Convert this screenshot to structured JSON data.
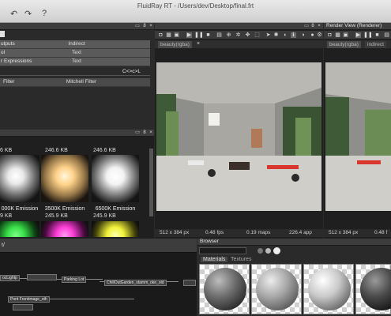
{
  "window": {
    "title": "FluidRay RT - /Users/dev/Desktop/final.frt"
  },
  "toolbar": {
    "undo": "↶",
    "redo": "↷",
    "help": "?"
  },
  "properties": {
    "rows": [
      {
        "label": "utputs",
        "value": "Indirect"
      },
      {
        "label": "ol",
        "value": "Text"
      },
      {
        "label": "r Expressions",
        "value": "Text"
      },
      {
        "label": "",
        "value": ""
      },
      {
        "label": "Filter",
        "value": "Mitchell Filter"
      }
    ],
    "shortcut": "C<>c>L"
  },
  "library": {
    "items": [
      {
        "size": "6 KB",
        "label": "000K Emission",
        "glow": "#f4f4f4"
      },
      {
        "size": "246.6 KB",
        "label": "3500K Emission",
        "glow": "#ffd79a"
      },
      {
        "size": "246.6 KB",
        "label": "6500K Emission",
        "glow": "#ffffff"
      },
      {
        "size": "9 KB",
        "label": "",
        "glow": "#39e04a"
      },
      {
        "size": "245.9 KB",
        "label": "",
        "glow": "#ff3fd8"
      },
      {
        "size": "245.9 KB",
        "label": "",
        "glow": "#f2f23a"
      }
    ]
  },
  "viewport1": {
    "tab": "beauty(rgba)",
    "status": {
      "res": "512 x 384 px",
      "fps": "0.48 fps",
      "maps": "0.19 maps",
      "app": "226.4 app"
    }
  },
  "viewport2": {
    "title": "Render View (Renderer)",
    "tab1": "beauty(rgba)",
    "tab2": "indirect",
    "status": {
      "res": "512 x 384 px",
      "fps": "0.48 f"
    }
  },
  "graph": {
    "path": "t/",
    "nodes": [
      "ocLightp",
      "Parking Lot",
      "ChillOutGarden_stamm_oke_old",
      "Pont Frontimage_oth"
    ]
  },
  "browser": {
    "title": "Browser",
    "tabs": [
      "Materials",
      "Textures"
    ]
  }
}
